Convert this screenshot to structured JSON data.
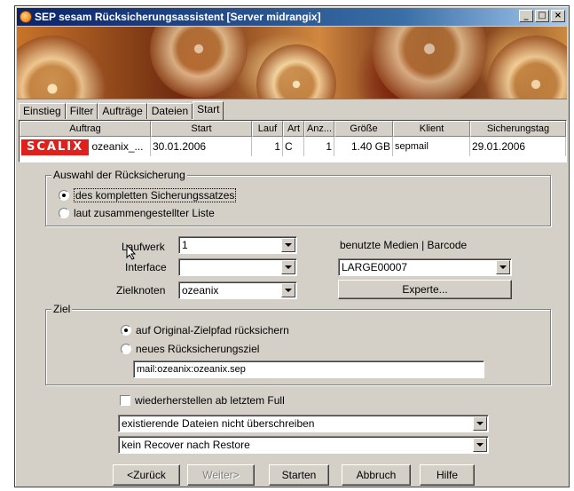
{
  "window": {
    "title": "SEP sesam Rücksicherungsassistent [Server midrangix]",
    "controls": [
      "_",
      "□",
      "×"
    ]
  },
  "tabs": [
    {
      "label": "Einstieg"
    },
    {
      "label": "Filter"
    },
    {
      "label": "Aufträge"
    },
    {
      "label": "Dateien"
    },
    {
      "label": "Start"
    }
  ],
  "table": {
    "headers": [
      "Auftrag",
      "Start",
      "Lauf",
      "Art",
      "Anz...",
      "Größe",
      "Klient",
      "Sicherungstag"
    ],
    "row": {
      "logo": "SCALIX",
      "auftrag": "ozeanix_...",
      "start": "30.01.2006",
      "lauf": "1",
      "art": "C",
      "anz": "1",
      "groesse": "1.40 GB",
      "klient": "sepmail",
      "sicherungstag": "29.01.2006"
    }
  },
  "auswahl": {
    "title": "Auswahl der Rücksicherung",
    "option_full": "des kompletten Sicherungssatzes",
    "option_list": "laut zusammengestellter Liste",
    "selected": "option_full"
  },
  "laufwerk": {
    "label": "Laufwerk",
    "value": "1"
  },
  "interface": {
    "label": "Interface",
    "value": ""
  },
  "zielknoten": {
    "label": "Zielknoten",
    "value": "ozeanix"
  },
  "medien": {
    "label": "benutzte Medien | Barcode",
    "value": "LARGE00007",
    "experte_label": "Experte..."
  },
  "ziel": {
    "title": "Ziel",
    "option_original": "auf Original-Zielpfad rücksichern",
    "option_new": "neues Rücksicherungsziel",
    "selected": "option_original",
    "path": "mail:ozeanix:ozeanix.sep"
  },
  "options": {
    "restore_full_label": "wiederherstellen ab letztem Full",
    "restore_full_checked": false,
    "overwrite_value": "existierende Dateien nicht überschreiben",
    "recover_value": "kein Recover nach Restore"
  },
  "buttons": {
    "back": "<Zurück",
    "next": "Weiter>",
    "start": "Starten",
    "cancel": "Abbruch",
    "help": "Hilfe"
  }
}
